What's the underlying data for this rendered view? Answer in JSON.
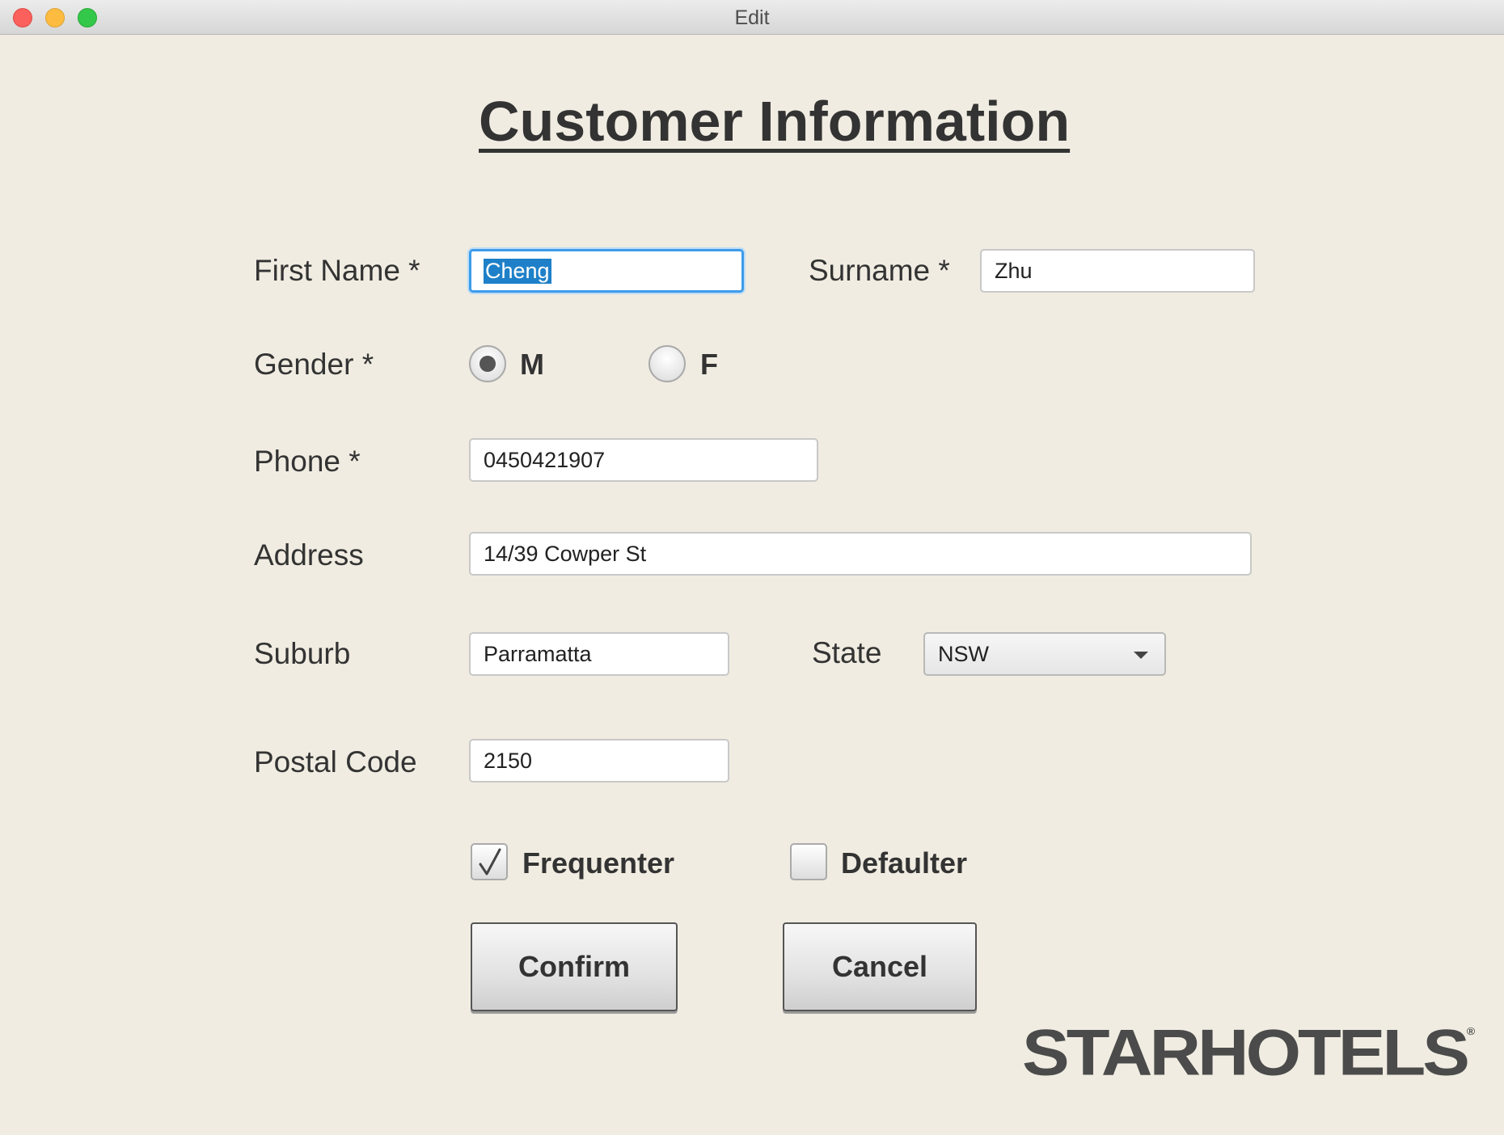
{
  "window": {
    "title": "Edit"
  },
  "form": {
    "heading": "Customer Information",
    "first_name": {
      "label": "First Name *",
      "value": "Cheng"
    },
    "surname": {
      "label": "Surname *",
      "value": "Zhu"
    },
    "gender": {
      "label": "Gender *",
      "options": [
        "M",
        "F"
      ],
      "selected": "M"
    },
    "phone": {
      "label": "Phone *",
      "value": "0450421907"
    },
    "address": {
      "label": "Address",
      "value": "14/39 Cowper St"
    },
    "suburb": {
      "label": "Suburb",
      "value": "Parramatta"
    },
    "state": {
      "label": "State",
      "value": "NSW"
    },
    "postal_code": {
      "label": "Postal Code",
      "value": "2150"
    },
    "frequenter": {
      "label": "Frequenter",
      "checked": true
    },
    "defaulter": {
      "label": "Defaulter",
      "checked": false
    },
    "confirm_label": "Confirm",
    "cancel_label": "Cancel"
  },
  "brand": {
    "logo_text": "STARHOTELS",
    "logo_mark": "®"
  },
  "colors": {
    "background": "#f0ece1",
    "focus": "#3d9be9",
    "selection": "#1e80c8"
  }
}
